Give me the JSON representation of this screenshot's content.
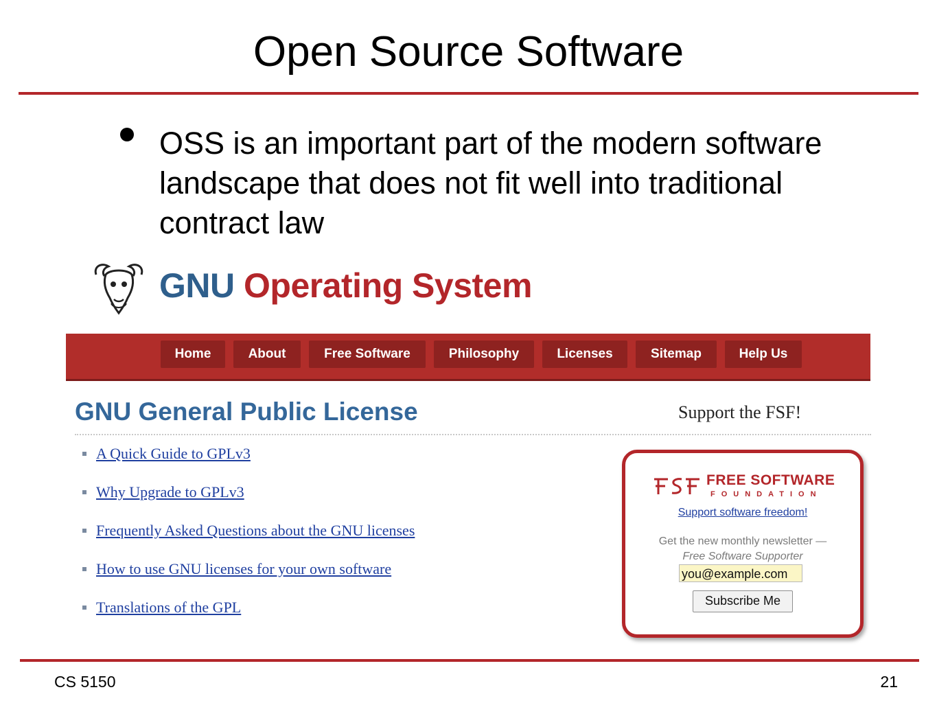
{
  "slide": {
    "title": "Open Source Software",
    "bullet": "OSS is an important part of the modern software landscape that does not fit well into traditional contract law",
    "footer_left": "CS 5150",
    "footer_right": "21"
  },
  "screenshot": {
    "heading_gnu": "GNU",
    "heading_rest": "Operating System",
    "nav_items": [
      "Home",
      "About",
      "Free Software",
      "Philosophy",
      "Licenses",
      "Sitemap",
      "Help Us"
    ],
    "page_title": "GNU General Public License",
    "support_label": "Support the FSF!",
    "links": [
      "A Quick Guide to GPLv3",
      "Why Upgrade to GPLv3",
      "Frequently Asked Questions about the GNU licenses",
      "How to use GNU licenses for your own software",
      "Translations of the GPL"
    ],
    "fsf_box": {
      "name_line1": "FREE SOFTWARE",
      "name_line2": "FOUNDATION",
      "support_link": "Support software freedom!",
      "newsletter": "Get the new monthly newsletter —",
      "newsletter_name": "Free Software Supporter",
      "email_value": "you@example.com",
      "subscribe_label": "Subscribe Me"
    }
  },
  "colors": {
    "accent_red": "#b3262a",
    "gnu_blue": "#2f5f8c",
    "link_blue": "#1f3fa0"
  },
  "icons": [
    "gnu-head-icon",
    "fsf-logo-icon"
  ]
}
